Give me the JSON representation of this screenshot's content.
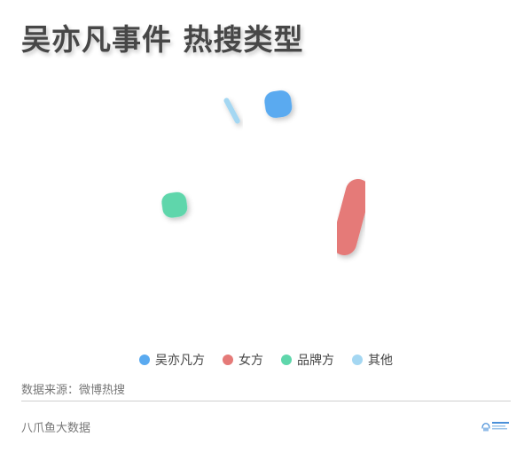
{
  "title": "吴亦凡事件 热搜类型",
  "source": "数据来源：微博热搜",
  "footer": "八爪鱼大数据",
  "chart_data": {
    "type": "scatter",
    "title": "吴亦凡事件 热搜类型",
    "legend_position": "bottom-center",
    "grid": false,
    "series": [
      {
        "name": "吴亦凡方",
        "color": "#5aaaf0",
        "shape": "blob",
        "points": [
          {
            "x": 0.523,
            "y": 0.875,
            "size": 15
          }
        ]
      },
      {
        "name": "女方",
        "color": "#e57a78",
        "shape": "stroke",
        "points": [
          {
            "x": 0.66,
            "y": 0.45,
            "size": 60
          }
        ]
      },
      {
        "name": "品牌方",
        "color": "#5fd6ab",
        "shape": "blob",
        "points": [
          {
            "x": 0.328,
            "y": 0.496,
            "size": 14
          }
        ]
      },
      {
        "name": "其他",
        "color": "#a4d7f2",
        "shape": "stroke",
        "points": [
          {
            "x": 0.436,
            "y": 0.85,
            "size": 26
          }
        ]
      }
    ]
  }
}
